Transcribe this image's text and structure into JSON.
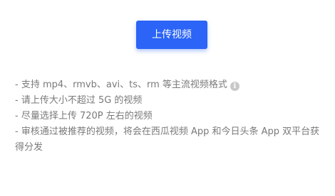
{
  "upload": {
    "button_label": "上传视频"
  },
  "tips": {
    "line1": "- 支持 mp4、rmvb、avi、ts、rm 等主流视频格式",
    "info_icon_glyph": "i",
    "line2": "- 请上传大小不超过 5G 的视频",
    "line3": "- 尽量选择上传 720P 左右的视频",
    "line4": "- 审核通过被推荐的视频，将会在西瓜视频 App 和今日头条 App 双平台获得分发"
  },
  "colors": {
    "accent": "#2b64f6",
    "tip_text": "#7a7a7a",
    "info_icon": "#c8c8c8"
  }
}
